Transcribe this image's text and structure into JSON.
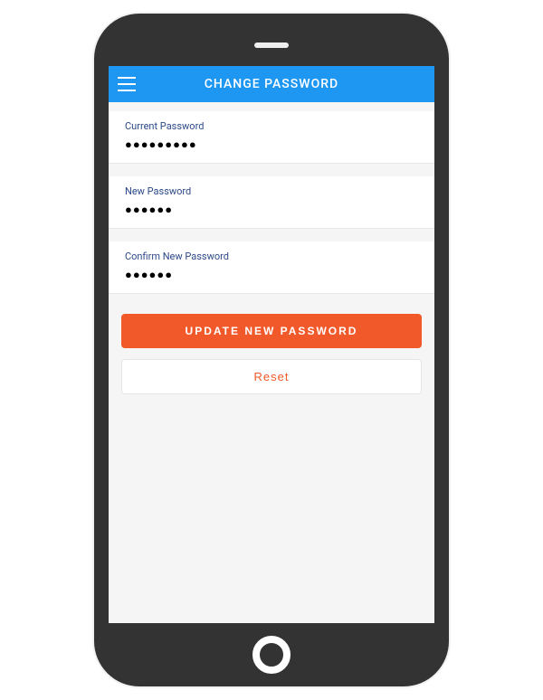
{
  "header": {
    "title": "CHANGE PASSWORD"
  },
  "fields": {
    "current": {
      "label": "Current Password",
      "value": "●●●●●●●●●"
    },
    "new": {
      "label": "New Password",
      "value": "●●●●●●"
    },
    "confirm": {
      "label": "Confirm New Password",
      "value": "●●●●●●"
    }
  },
  "buttons": {
    "update": "UPDATE NEW PASSWORD",
    "reset": "Reset"
  }
}
